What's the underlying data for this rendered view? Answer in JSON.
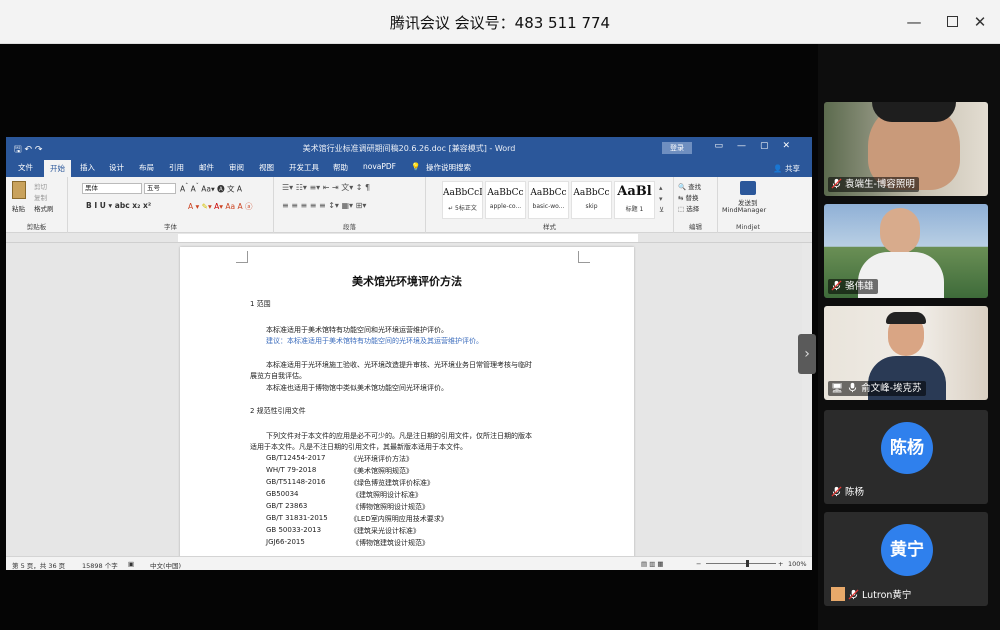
{
  "window": {
    "title": "腾讯会议 会议号：483 511 774",
    "minimize_icon": "minimize-icon",
    "maximize_icon": "maximize-icon",
    "close_icon": "close-icon"
  },
  "word": {
    "doc_title": "美术馆行业标准调研期间稿20.6.26.doc [兼容模式] - Word",
    "login_label": "登录",
    "tabs": [
      "文件",
      "开始",
      "插入",
      "设计",
      "布局",
      "引用",
      "邮件",
      "审阅",
      "视图",
      "开发工具",
      "帮助",
      "novaPDF",
      "操作说明搜索"
    ],
    "active_tab": "开始",
    "share_label": "共享",
    "ribbon": {
      "clipboard": {
        "label": "剪贴板",
        "paste": "粘贴",
        "cut": "剪切",
        "copy": "复制",
        "format_painter": "格式刷"
      },
      "font": {
        "label": "字体",
        "font_name": "黑体",
        "font_size": "五号"
      },
      "paragraph": {
        "label": "段落"
      },
      "styles": {
        "label": "样式",
        "items": [
          {
            "sample": "AaBbCcDc",
            "name": "↵ 5标正文"
          },
          {
            "sample": "AaBbCc",
            "name": "apple-co..."
          },
          {
            "sample": "AaBbCc",
            "name": "basic-wo..."
          },
          {
            "sample": "AaBbCc",
            "name": "skip"
          },
          {
            "sample": "AaBl",
            "name": "标题 1"
          }
        ]
      },
      "editing": {
        "label": "编辑",
        "find": "查找",
        "replace": "替换",
        "select": "选择"
      },
      "mindjet": {
        "label": "Mindjet",
        "send_to": "发送到",
        "mindmanager": "MindManager"
      }
    },
    "status": {
      "page": "第 5 页，共 36 页",
      "words": "15898 个字",
      "language": "中文(中国)",
      "zoom": "100%"
    },
    "document": {
      "title": "美术馆光环境评价方法",
      "lines": [
        "1    范围",
        "本标准适用于美术馆特有功能空间和光环境运营维护评价。",
        "建议：本标准适用于美术馆特有功能空间的光环境及其运营维护评价。",
        "本标准适用于光环境施工验收、光环境改造提升审核、光环境业务日常管理考核与临时",
        "展览方自我评估。",
        "本标准也适用于博物馆中类似美术馆功能空间光环境评价。",
        "2    规范性引用文件",
        "下列文件对于本文件的应用是必不可少的。凡是注日期的引用文件，仅所注日期的版本",
        "适用于本文件。凡是不注日期的引用文件，其最新版本适用于本文件。"
      ],
      "references": [
        {
          "code": "GB/T12454-2017",
          "name": "《光环境评价方法》"
        },
        {
          "code": "WH/T 79-2018",
          "name": "《美术馆照明规范》"
        },
        {
          "code": "GB/T51148-2016",
          "name": "《绿色博览建筑评价标准》"
        },
        {
          "code": "GB50034",
          "name": "《建筑照明设计标准》"
        },
        {
          "code": "GB/T 23863",
          "name": "《博物馆照明设计规范》"
        },
        {
          "code": "GB/T 31831-2015",
          "name": "《LED室内照明应用技术要求》"
        },
        {
          "code": "GB 50033-2013",
          "name": "《建筑采光设计标准》"
        },
        {
          "code": "JGJ66-2015",
          "name": "《博物馆建筑设计规范》"
        }
      ]
    }
  },
  "participants": [
    {
      "name": "袁端生-博容照明",
      "type": "video"
    },
    {
      "name": "骆伟雄",
      "type": "video"
    },
    {
      "name": "俞文峰-埃克苏",
      "type": "video"
    },
    {
      "name": "陈杨",
      "type": "avatar",
      "avatar_text": "陈杨"
    },
    {
      "name": "Lutron黄宁",
      "type": "avatar",
      "avatar_text": "黄宁"
    }
  ],
  "colors": {
    "avatar_bg": "#2f80ed",
    "word_blue": "#2b579a"
  }
}
